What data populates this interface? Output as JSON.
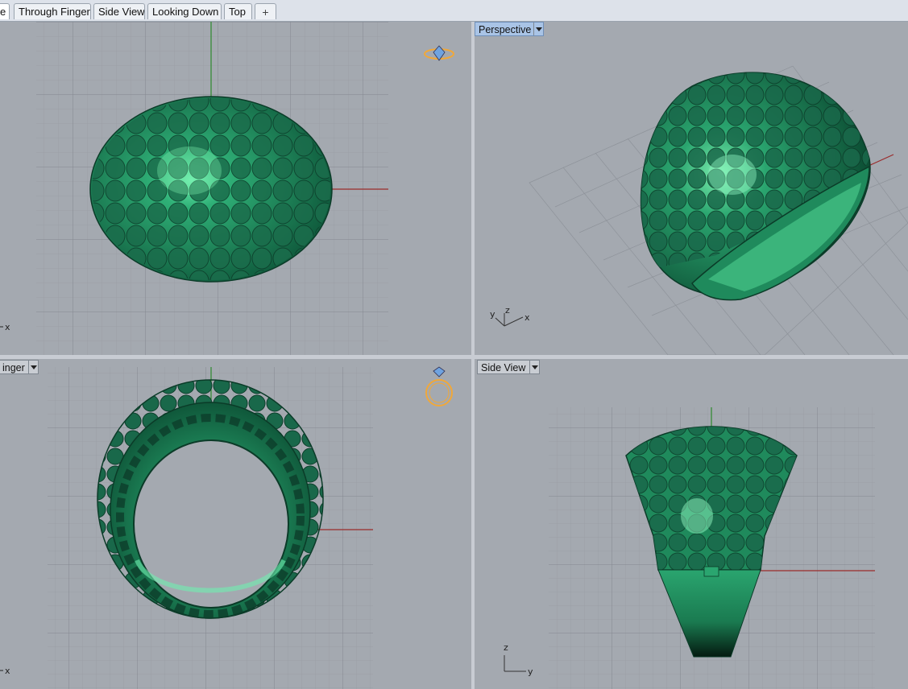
{
  "tabs": [
    {
      "label": "e",
      "active": true
    },
    {
      "label": "Through Finger",
      "active": false
    },
    {
      "label": "Side View",
      "active": false
    },
    {
      "label": "Looking Down",
      "active": false
    },
    {
      "label": "Top",
      "active": false
    }
  ],
  "tab_add_icon": "+",
  "viewports": {
    "top_left": {
      "axis_label": "x"
    },
    "perspective": {
      "title": "Perspective",
      "axis_x": "x",
      "axis_y": "y",
      "axis_z": "z"
    },
    "through_finger": {
      "title": "inger",
      "axis_label": "x"
    },
    "side_view": {
      "title": "Side View",
      "axis_z": "z",
      "axis_y": "y"
    }
  },
  "colors": {
    "viewport_bg": "#a4a9b0",
    "model_green": "#1e7a55",
    "model_highlight": "#7df0b0",
    "grid_line": "#8e939a",
    "axis_x": "#9a2b2b",
    "axis_y": "#2d8a2d",
    "active_title": "#a9c4e6"
  }
}
